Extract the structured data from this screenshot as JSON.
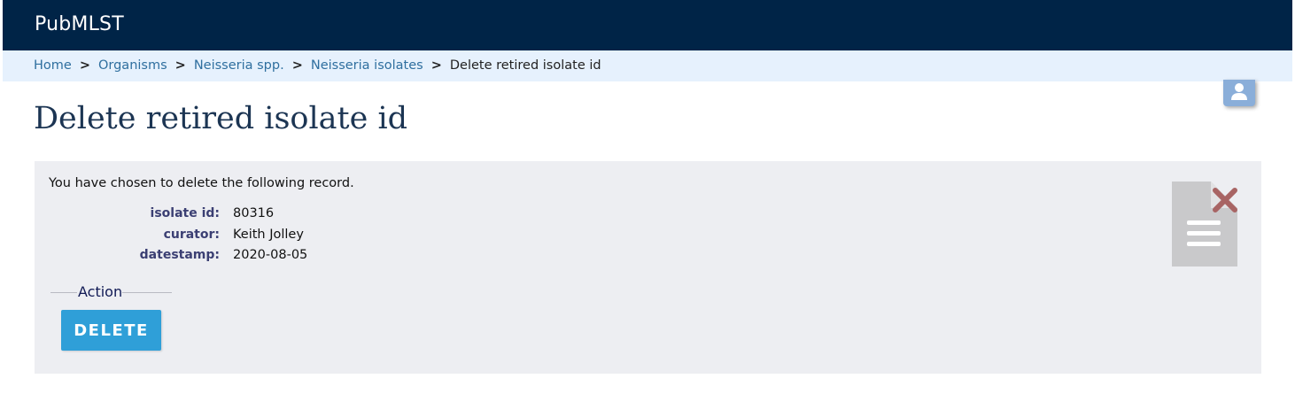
{
  "header": {
    "site_title": "PubMLST"
  },
  "breadcrumb": {
    "items": [
      {
        "label": "Home",
        "link": true
      },
      {
        "label": "Organisms",
        "link": true
      },
      {
        "label": "Neisseria spp.",
        "link": true
      },
      {
        "label": "Neisseria isolates",
        "link": true
      },
      {
        "label": "Delete retired isolate id",
        "link": false
      }
    ],
    "separator": ">"
  },
  "page": {
    "title": "Delete retired isolate id"
  },
  "panel": {
    "intro": "You have chosen to delete the following record.",
    "record": [
      {
        "key": "isolate id:",
        "value": "80316"
      },
      {
        "key": "curator:",
        "value": "Keith Jolley"
      },
      {
        "key": "datestamp:",
        "value": "2020-08-05"
      }
    ],
    "action_legend": "Action",
    "delete_label": "DELETE"
  },
  "icons": {
    "user": "user-icon",
    "document_delete": "document-delete-icon"
  },
  "colors": {
    "header_bg": "#002447",
    "breadcrumb_bg": "#e6f1fd",
    "panel_bg": "#edeef2",
    "button_bg": "#2f9fd8",
    "title_color": "#1c3553",
    "delete_x": "#a86464"
  }
}
